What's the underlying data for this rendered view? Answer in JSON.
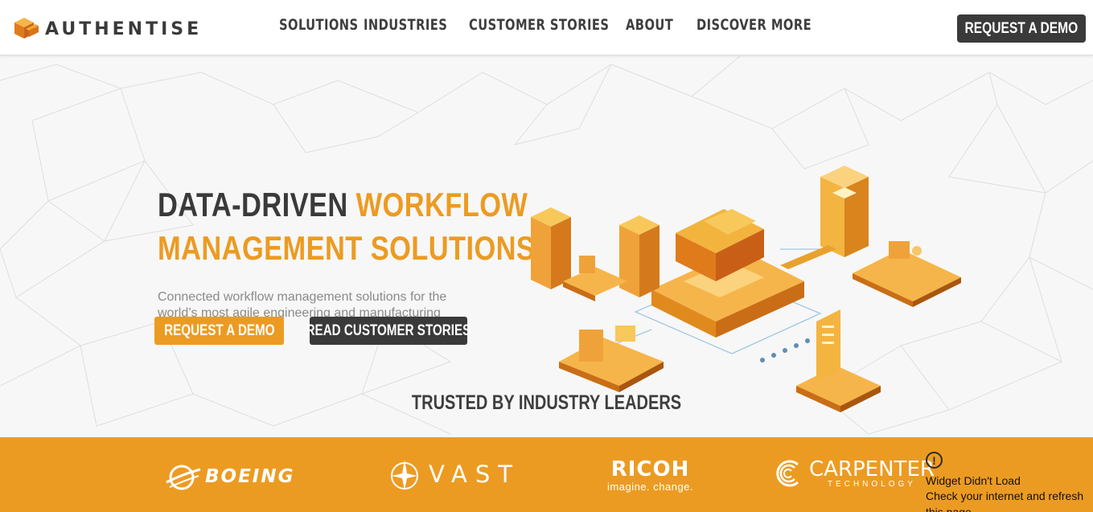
{
  "brand": {
    "name": "AUTHENTISE",
    "logo_icon": "authentise-cube-icon"
  },
  "nav": {
    "items": [
      "SOLUTIONS",
      "INDUSTRIES",
      "CUSTOMER STORIES",
      "ABOUT",
      "DISCOVER MORE"
    ],
    "cta_label": "REQUEST A DEMO"
  },
  "hero": {
    "headline_dark": "DATA-DRIVEN ",
    "headline_orange_1": "WORKFLOW",
    "headline_orange_2": "MANAGEMENT SOLUTIONS",
    "subtext": "Connected workflow management solutions for the world’s most agile engineering and manufacturing operations.",
    "primary_button": "REQUEST A DEMO",
    "secondary_button": "READ CUSTOMER STORIES",
    "trusted_heading": "TRUSTED BY INDUSTRY LEADERS"
  },
  "partners": {
    "boeing": "BOEING",
    "vast": "VAST",
    "ricoh_name": "RICOH",
    "ricoh_tagline": "imagine. change.",
    "carpenter_name": "CARPENTER",
    "carpenter_sub": "TECHNOLOGY"
  },
  "widget": {
    "icon": "alert-icon",
    "title": "Widget Didn't Load",
    "message": "Check your internet and refresh this page."
  },
  "colors": {
    "accent": "#ec9b22",
    "dark": "#3a3a3a",
    "text_muted": "#8a8a8a",
    "background": "#f7f7f7"
  }
}
